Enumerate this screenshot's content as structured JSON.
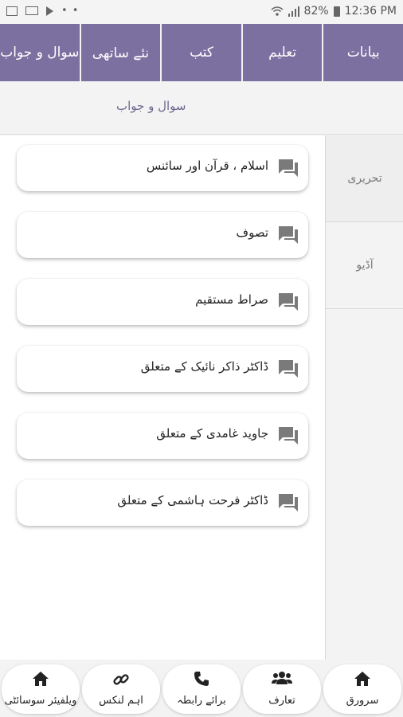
{
  "status_bar": {
    "battery": "82%",
    "time": "12:36 PM"
  },
  "tabs": [
    {
      "label": "بیانات"
    },
    {
      "label": "تعلیم"
    },
    {
      "label": "کتب"
    },
    {
      "label": "نئے ساتھی"
    },
    {
      "label": "سوال و جواب"
    }
  ],
  "subtitle": "سوال و جواب",
  "side_panel": [
    {
      "label": "تحریری"
    },
    {
      "label": "آڈیو"
    }
  ],
  "topics": [
    {
      "label": "اسلام ، قرآن اور سائنس"
    },
    {
      "label": "تصوف"
    },
    {
      "label": "صراط مستقیم"
    },
    {
      "label": "ڈاکٹر ذاکر نائیک کے متعلق"
    },
    {
      "label": "جاوید غامدی کے متعلق"
    },
    {
      "label": "ڈاکٹر فرحت ہاشمی کے متعلق"
    }
  ],
  "bottom_nav": [
    {
      "label": "سرورق",
      "icon": "home-icon"
    },
    {
      "label": "تعارف",
      "icon": "people-icon"
    },
    {
      "label": "برائے رابطہ",
      "icon": "phone-icon"
    },
    {
      "label": "اہم لنکس",
      "icon": "link-icon"
    },
    {
      "label": "ویلفیئر سوسائٹی",
      "icon": "home-icon"
    }
  ],
  "colors": {
    "accent": "#7c70a0",
    "subtitle": "#6e6790"
  }
}
